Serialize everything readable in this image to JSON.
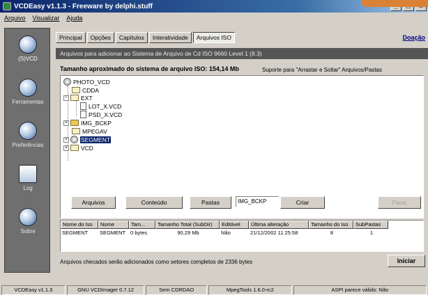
{
  "window": {
    "title": "VCDEasy v1.1.3 - Freeware by delphi.stuff",
    "min": "_",
    "max": "□",
    "close": "×"
  },
  "menu": [
    "Arquivo",
    "Visualizar",
    "Ajuda"
  ],
  "sidebar": [
    {
      "label": "(S)VCD",
      "icon": "disc-icon"
    },
    {
      "label": "Ferramentas",
      "icon": "tools-icon"
    },
    {
      "label": "Preferências",
      "icon": "preferences-icon"
    },
    {
      "label": "Log",
      "icon": "log-icon"
    },
    {
      "label": "Sobre",
      "icon": "info-icon"
    }
  ],
  "tabs": [
    "Principal",
    "Opções",
    "Capítulos",
    "Interatividade",
    "Arquivos ISO"
  ],
  "doacao": "Doação",
  "header": "Arquivos para adicionar ao Sistema de Arquivo de Cd ISO 9660 Level 1 (8.3)",
  "size_label": "Tamanho aproximado do sistema de arquivo ISO: 154,14 Mb",
  "dragdrop": "Suporte para \"Arrastar e Soltar\" Arquivos/Pastas",
  "tree": [
    {
      "label": "PHOTO_VCD",
      "type": "disc"
    },
    {
      "label": "CDDA",
      "type": "folder"
    },
    {
      "label": "EXT",
      "type": "folder",
      "exp": "−"
    },
    {
      "label": "LOT_X.VCD",
      "type": "file"
    },
    {
      "label": "PSD_X.VCD",
      "type": "file"
    },
    {
      "label": "IMG_BCKP",
      "type": "folder-yellow",
      "exp": "+"
    },
    {
      "label": "MPEGAV",
      "type": "folder"
    },
    {
      "label": "SEGMENT",
      "type": "disc",
      "exp": "+",
      "selected": true
    },
    {
      "label": "VCD",
      "type": "folder",
      "exp": "+"
    }
  ],
  "actions": {
    "arquivos": "Arquivos",
    "conteudo": "Conteúdo",
    "pastas": "Pastas",
    "folder_name": "IMG_BCKP",
    "criar": "Criar",
    "parar": "Parar"
  },
  "list": {
    "columns": [
      "Nome do Iso",
      "Nome",
      "Tam...",
      "Tamanho Total (SubDir)",
      "Editável",
      "Última alteração",
      "Tamanho do Iso",
      "SubPastas"
    ],
    "rows": [
      [
        "SEGMENT",
        "SEGMENT",
        "0 bytes",
        "90,29 Mb",
        "Não",
        "21/12/2002 11:25:58",
        "8",
        "1"
      ]
    ]
  },
  "note": "Arquivos checados serão adicionados como setores completos de 2336 bytes",
  "iniciar": "Iniciar",
  "status": [
    "VCDEasy v1.1.3",
    "GNU VCDImager 0.7.12",
    "Sem CDRDAO",
    "MpegTools 1.6.0-rc2",
    "ASPI parece válido: Não"
  ]
}
